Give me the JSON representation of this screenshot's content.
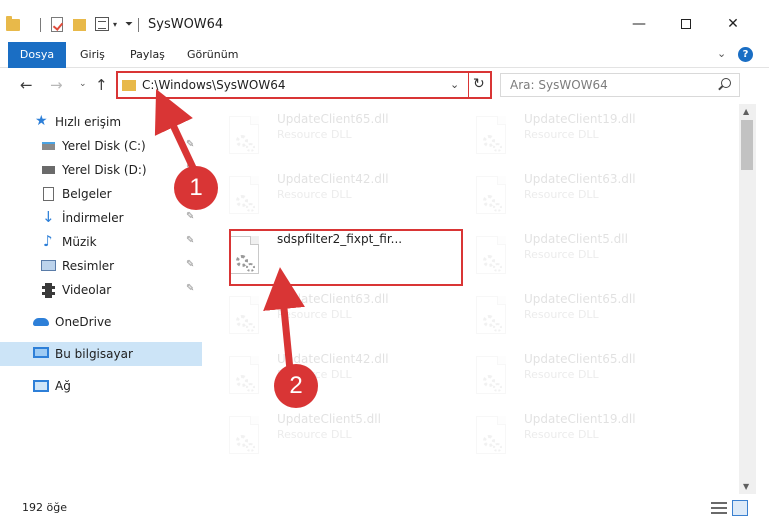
{
  "window": {
    "title": "SysWOW64",
    "minimize": "—",
    "close": "✕"
  },
  "ribbon": {
    "tabs": [
      "Dosya",
      "Giriş",
      "Paylaş",
      "Görünüm"
    ],
    "help": "?"
  },
  "nav": {
    "back": "←",
    "forward": "→",
    "up": "↑",
    "address": "C:\\Windows\\SysWOW64",
    "refresh": "↻",
    "search_placeholder": "Ara: SysWOW64"
  },
  "sidebar": {
    "items": [
      {
        "label": "Hızlı erişim",
        "icon": "star-icon",
        "pinned": false
      },
      {
        "label": "Yerel Disk (C:)",
        "icon": "drive-icon",
        "pinned": true
      },
      {
        "label": "Yerel Disk (D:)",
        "icon": "drive-icon",
        "pinned": true
      },
      {
        "label": "Belgeler",
        "icon": "document-icon",
        "pinned": true
      },
      {
        "label": "İndirmeler",
        "icon": "download-icon",
        "pinned": true
      },
      {
        "label": "Müzik",
        "icon": "music-icon",
        "pinned": true
      },
      {
        "label": "Resimler",
        "icon": "pictures-icon",
        "pinned": true
      },
      {
        "label": "Videolar",
        "icon": "video-icon",
        "pinned": true
      },
      {
        "label": "OneDrive",
        "icon": "cloud-icon",
        "pinned": false
      },
      {
        "label": "Bu bilgisayar",
        "icon": "computer-icon",
        "pinned": false,
        "selected": true
      },
      {
        "label": "Ağ",
        "icon": "network-icon",
        "pinned": false
      }
    ]
  },
  "files": [
    {
      "name": "UpdateClient65.dll",
      "desc": "Resource DLL",
      "faded": true
    },
    {
      "name": "UpdateClient19.dll",
      "desc": "Resource DLL",
      "faded": true
    },
    {
      "name": "UpdateClient42.dll",
      "desc": "Resource DLL",
      "faded": true
    },
    {
      "name": "UpdateClient63.dll",
      "desc": "Resource DLL",
      "faded": true
    },
    {
      "name": "sdspfilter2_fixpt_fir...",
      "desc": "",
      "faded": false
    },
    {
      "name": "UpdateClient5.dll",
      "desc": "Resource DLL",
      "faded": true
    },
    {
      "name": "UpdateClient63.dll",
      "desc": "Resource DLL",
      "faded": true
    },
    {
      "name": "UpdateClient65.dll",
      "desc": "Resource DLL",
      "faded": true
    },
    {
      "name": "UpdateClient42.dll",
      "desc": "Resource DLL",
      "faded": true
    },
    {
      "name": "UpdateClient65.dll",
      "desc": "Resource DLL",
      "faded": true
    },
    {
      "name": "UpdateClient5.dll",
      "desc": "Resource DLL",
      "faded": true
    },
    {
      "name": "UpdateClient19.dll",
      "desc": "Resource DLL",
      "faded": true
    }
  ],
  "status": {
    "count": "192 öğe"
  },
  "annotations": {
    "step1": "1",
    "step2": "2",
    "color": "#d93535"
  }
}
